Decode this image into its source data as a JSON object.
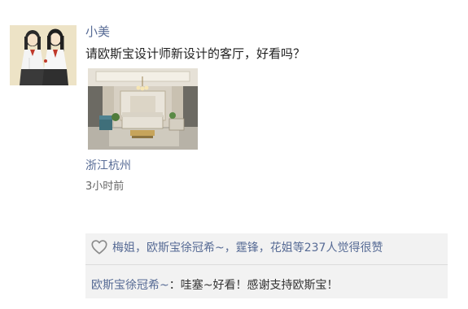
{
  "post": {
    "username": "小美",
    "text": "请欧斯宝设计师新设计的客厅，好看吗？",
    "location": "浙江杭州",
    "time": "3小时前",
    "avatar_icon": "avatar-illustration-two-girls",
    "photo_icon": "living-room-photo"
  },
  "likes": {
    "icon": "heart-icon",
    "text": "梅姐，欧斯宝徐冠希~，霆锋，花姐等237人觉得很赞"
  },
  "comment": {
    "author": "欧斯宝徐冠希~",
    "separator": "：",
    "text": "哇塞~好看！感谢支持欧斯宝！"
  },
  "colors": {
    "link": "#576b95",
    "panel": "#f2f2f2",
    "text": "#222222",
    "muted": "#666666"
  }
}
